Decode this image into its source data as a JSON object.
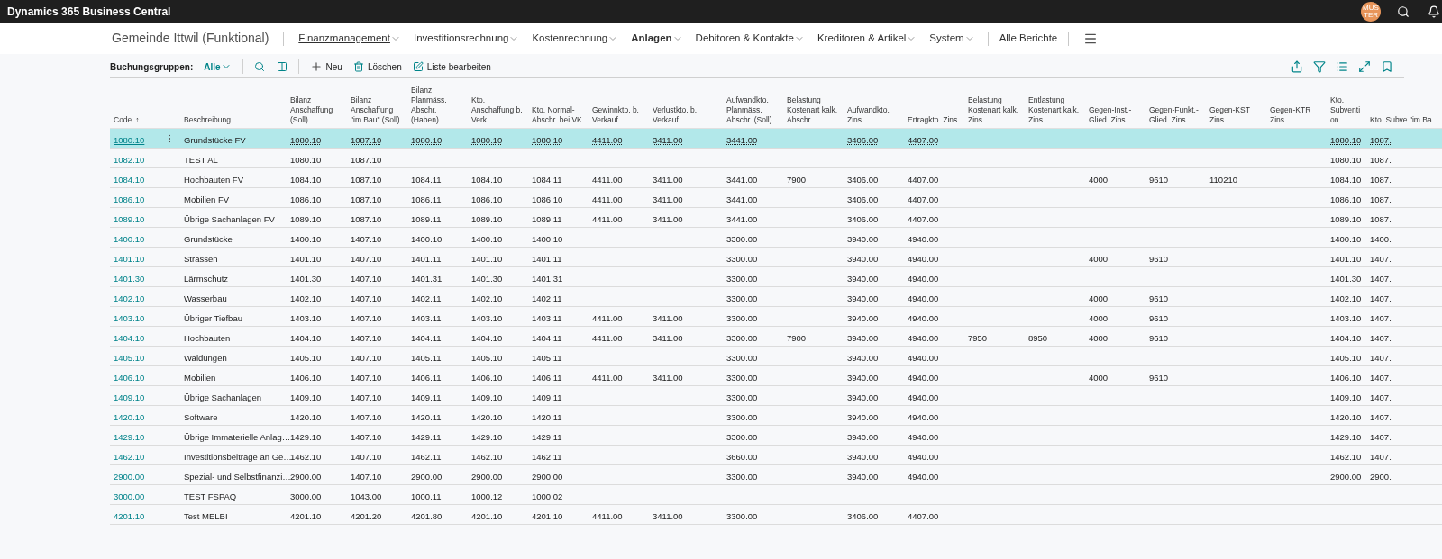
{
  "app_bar": {
    "title": "Dynamics 365 Business Central",
    "avatar": "MUS TER"
  },
  "nav": {
    "company": "Gemeinde Ittwil (Funktional)",
    "items": [
      {
        "label": "Finanzmanagement",
        "selected": false,
        "focused": true
      },
      {
        "label": "Investitionsrechnung",
        "selected": false,
        "focused": false
      },
      {
        "label": "Kostenrechnung",
        "selected": false,
        "focused": false
      },
      {
        "label": "Anlagen",
        "selected": true,
        "focused": false
      },
      {
        "label": "Debitoren & Kontakte",
        "selected": false,
        "focused": false
      },
      {
        "label": "Kreditoren & Artikel",
        "selected": false,
        "focused": false
      },
      {
        "label": "System",
        "selected": false,
        "focused": false
      }
    ],
    "reports": "Alle Berichte"
  },
  "toolbar": {
    "label": "Buchungsgruppen:",
    "filter": "Alle",
    "actions": [
      {
        "kind": "new",
        "label": "Neu"
      },
      {
        "kind": "delete",
        "label": "Löschen"
      },
      {
        "kind": "edit",
        "label": "Liste bearbeiten"
      }
    ]
  },
  "table": {
    "columns": [
      {
        "label": "Code",
        "sort": "↑"
      },
      {
        "label": "Beschreibung"
      },
      {
        "label": "Bilanz Anschaffung (Soll)"
      },
      {
        "label": "Bilanz Anschaffung \"im Bau\" (Soll)"
      },
      {
        "label": "Bilanz Planmäss. Abschr. (Haben)"
      },
      {
        "label": "Kto. Anschaffung b. Verk."
      },
      {
        "label": "Kto. Normal-Abschr. bei VK"
      },
      {
        "label": "Gewinnkto. b. Verkauf"
      },
      {
        "label": "Verlustkto. b. Verkauf"
      },
      {
        "label": "Aufwandkto. Planmäss. Abschr. (Soll)"
      },
      {
        "label": "Belastung Kostenart kalk. Abschr."
      },
      {
        "label": "Aufwandkto. Zins"
      },
      {
        "label": "Ertragkto. Zins"
      },
      {
        "label": "Belastung Kostenart kalk. Zins"
      },
      {
        "label": "Entlastung Kostenart kalk. Zins"
      },
      {
        "label": "Gegen-Inst.-Glied. Zins"
      },
      {
        "label": "Gegen-Funkt.-Glied. Zins"
      },
      {
        "label": "Gegen-KST Zins"
      },
      {
        "label": "Gegen-KTR Zins"
      },
      {
        "label": "Kto. Subvention"
      },
      {
        "label": "Kto. Subve \"im Ba"
      }
    ],
    "rows": [
      {
        "selected": true,
        "cells": [
          "1080.10",
          "Grundstücke FV",
          "1080.10",
          "1087.10",
          "1080.10",
          "1080.10",
          "1080.10",
          "4411.00",
          "3411.00",
          "3441.00",
          null,
          "3406.00",
          "4407.00",
          null,
          null,
          null,
          null,
          null,
          null,
          "1080.10",
          "1087."
        ]
      },
      {
        "selected": false,
        "cells": [
          "1082.10",
          "TEST AL",
          "1080.10",
          "1087.10",
          null,
          null,
          null,
          null,
          null,
          null,
          null,
          null,
          null,
          null,
          null,
          null,
          null,
          null,
          null,
          "1080.10",
          "1087."
        ]
      },
      {
        "selected": false,
        "cells": [
          "1084.10",
          "Hochbauten FV",
          "1084.10",
          "1087.10",
          "1084.11",
          "1084.10",
          "1084.11",
          "4411.00",
          "3411.00",
          "3441.00",
          "7900",
          "3406.00",
          "4407.00",
          null,
          null,
          "4000",
          "9610",
          "110210",
          null,
          "1084.10",
          "1087."
        ]
      },
      {
        "selected": false,
        "cells": [
          "1086.10",
          "Mobilien FV",
          "1086.10",
          "1087.10",
          "1086.11",
          "1086.10",
          "1086.10",
          "4411.00",
          "3411.00",
          "3441.00",
          null,
          "3406.00",
          "4407.00",
          null,
          null,
          null,
          null,
          null,
          null,
          "1086.10",
          "1087."
        ]
      },
      {
        "selected": false,
        "cells": [
          "1089.10",
          "Übrige Sachanlagen FV",
          "1089.10",
          "1087.10",
          "1089.11",
          "1089.10",
          "1089.11",
          "4411.00",
          "3411.00",
          "3441.00",
          null,
          "3406.00",
          "4407.00",
          null,
          null,
          null,
          null,
          null,
          null,
          "1089.10",
          "1087."
        ]
      },
      {
        "selected": false,
        "cells": [
          "1400.10",
          "Grundstücke",
          "1400.10",
          "1407.10",
          "1400.10",
          "1400.10",
          "1400.10",
          null,
          null,
          "3300.00",
          null,
          "3940.00",
          "4940.00",
          null,
          null,
          null,
          null,
          null,
          null,
          "1400.10",
          "1400."
        ]
      },
      {
        "selected": false,
        "cells": [
          "1401.10",
          "Strassen",
          "1401.10",
          "1407.10",
          "1401.11",
          "1401.10",
          "1401.11",
          null,
          null,
          "3300.00",
          null,
          "3940.00",
          "4940.00",
          null,
          null,
          "4000",
          "9610",
          null,
          null,
          "1401.10",
          "1407."
        ]
      },
      {
        "selected": false,
        "cells": [
          "1401.30",
          "Lärmschutz",
          "1401.30",
          "1407.10",
          "1401.31",
          "1401.30",
          "1401.31",
          null,
          null,
          "3300.00",
          null,
          "3940.00",
          "4940.00",
          null,
          null,
          null,
          null,
          null,
          null,
          "1401.30",
          "1407."
        ]
      },
      {
        "selected": false,
        "cells": [
          "1402.10",
          "Wasserbau",
          "1402.10",
          "1407.10",
          "1402.11",
          "1402.10",
          "1402.11",
          null,
          null,
          "3300.00",
          null,
          "3940.00",
          "4940.00",
          null,
          null,
          "4000",
          "9610",
          null,
          null,
          "1402.10",
          "1407."
        ]
      },
      {
        "selected": false,
        "cells": [
          "1403.10",
          "Übriger Tiefbau",
          "1403.10",
          "1407.10",
          "1403.11",
          "1403.10",
          "1403.11",
          "4411.00",
          "3411.00",
          "3300.00",
          null,
          "3940.00",
          "4940.00",
          null,
          null,
          "4000",
          "9610",
          null,
          null,
          "1403.10",
          "1407."
        ]
      },
      {
        "selected": false,
        "cells": [
          "1404.10",
          "Hochbauten",
          "1404.10",
          "1407.10",
          "1404.11",
          "1404.10",
          "1404.11",
          "4411.00",
          "3411.00",
          "3300.00",
          "7900",
          "3940.00",
          "4940.00",
          "7950",
          "8950",
          "4000",
          "9610",
          null,
          null,
          "1404.10",
          "1407."
        ]
      },
      {
        "selected": false,
        "cells": [
          "1405.10",
          "Waldungen",
          "1405.10",
          "1407.10",
          "1405.11",
          "1405.10",
          "1405.11",
          null,
          null,
          "3300.00",
          null,
          "3940.00",
          "4940.00",
          null,
          null,
          null,
          null,
          null,
          null,
          "1405.10",
          "1407."
        ]
      },
      {
        "selected": false,
        "cells": [
          "1406.10",
          "Mobilien",
          "1406.10",
          "1407.10",
          "1406.11",
          "1406.10",
          "1406.11",
          "4411.00",
          "3411.00",
          "3300.00",
          null,
          "3940.00",
          "4940.00",
          null,
          null,
          "4000",
          "9610",
          null,
          null,
          "1406.10",
          "1407."
        ]
      },
      {
        "selected": false,
        "cells": [
          "1409.10",
          "Übrige Sachanlagen",
          "1409.10",
          "1407.10",
          "1409.11",
          "1409.10",
          "1409.11",
          null,
          null,
          "3300.00",
          null,
          "3940.00",
          "4940.00",
          null,
          null,
          null,
          null,
          null,
          null,
          "1409.10",
          "1407."
        ]
      },
      {
        "selected": false,
        "cells": [
          "1420.10",
          "Software",
          "1420.10",
          "1407.10",
          "1420.11",
          "1420.10",
          "1420.11",
          null,
          null,
          "3300.00",
          null,
          "3940.00",
          "4940.00",
          null,
          null,
          null,
          null,
          null,
          null,
          "1420.10",
          "1407."
        ]
      },
      {
        "selected": false,
        "cells": [
          "1429.10",
          "Übrige Immaterielle Anlag…",
          "1429.10",
          "1407.10",
          "1429.11",
          "1429.10",
          "1429.11",
          null,
          null,
          "3300.00",
          null,
          "3940.00",
          "4940.00",
          null,
          null,
          null,
          null,
          null,
          null,
          "1429.10",
          "1407."
        ]
      },
      {
        "selected": false,
        "cells": [
          "1462.10",
          "Investitionsbeiträge an Ge…",
          "1462.10",
          "1407.10",
          "1462.11",
          "1462.10",
          "1462.11",
          null,
          null,
          "3660.00",
          null,
          "3940.00",
          "4940.00",
          null,
          null,
          null,
          null,
          null,
          null,
          "1462.10",
          "1407."
        ]
      },
      {
        "selected": false,
        "cells": [
          "2900.00",
          "Spezial- und Selbstfinanzi…",
          "2900.00",
          "1407.10",
          "2900.00",
          "2900.00",
          "2900.00",
          null,
          null,
          "3300.00",
          null,
          "3940.00",
          "4940.00",
          null,
          null,
          null,
          null,
          null,
          null,
          "2900.00",
          "2900."
        ]
      },
      {
        "selected": false,
        "cells": [
          "3000.00",
          "TEST FSPAQ",
          "3000.00",
          "1043.00",
          "1000.11",
          "1000.12",
          "1000.02",
          null,
          null,
          null,
          null,
          null,
          null,
          null,
          null,
          null,
          null,
          null,
          null,
          null,
          null
        ]
      },
      {
        "selected": false,
        "cells": [
          "4201.10",
          "Test MELBI",
          "4201.10",
          "4201.20",
          "4201.80",
          "4201.10",
          "4201.10",
          "4411.00",
          "3411.00",
          "3300.00",
          null,
          "3406.00",
          "4407.00",
          null,
          null,
          null,
          null,
          null,
          null,
          null,
          null
        ]
      }
    ]
  }
}
